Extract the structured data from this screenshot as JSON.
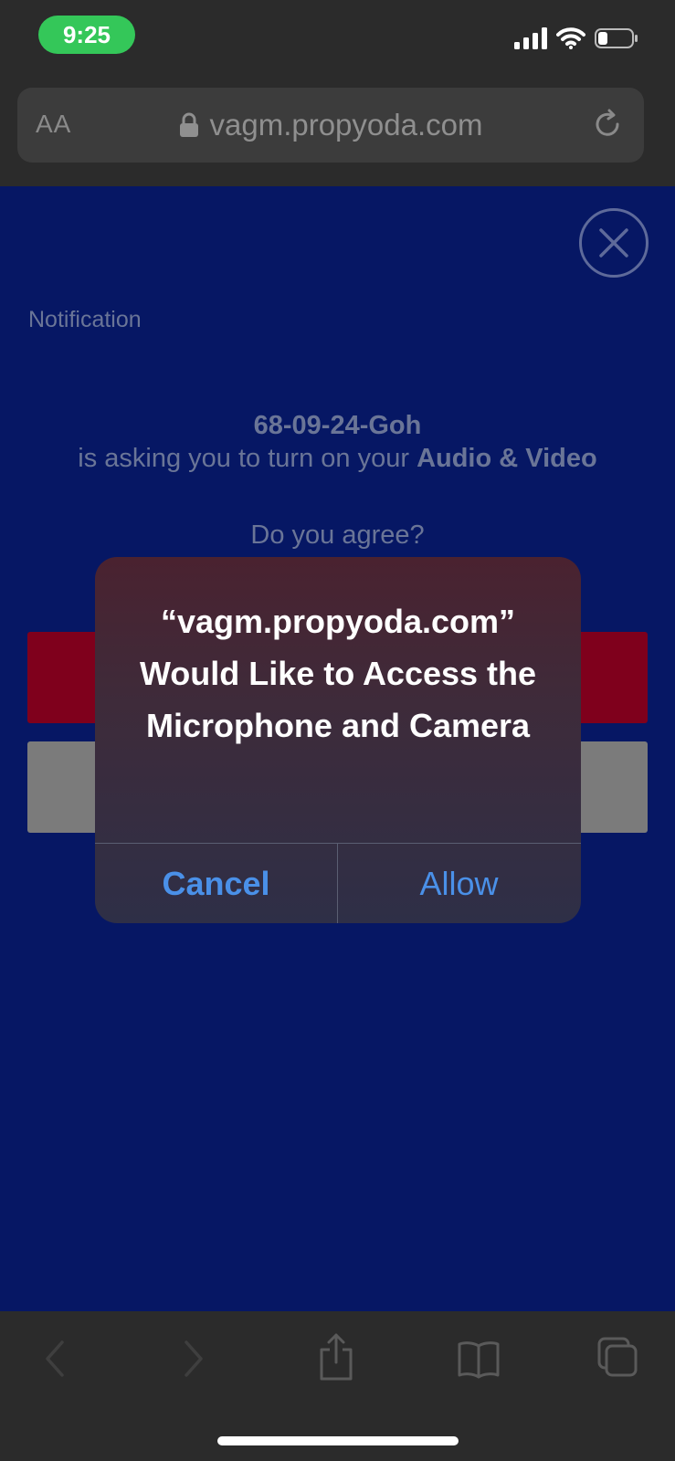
{
  "status_bar": {
    "time": "9:25",
    "icons": [
      "signal-icon",
      "wifi-icon",
      "battery-icon"
    ]
  },
  "browser": {
    "text_size_label": "AA",
    "url": "vagm.propyoda.com",
    "icons": [
      "lock-icon",
      "reload-icon"
    ]
  },
  "page": {
    "notification_label": "Notification",
    "requester": "68-09-24-Goh",
    "ask_text": "is asking you to turn on your",
    "ask_bold": "Audio & Video",
    "agree_question": "Do you agree?"
  },
  "alert": {
    "title": "“vagm.propyoda.com” Would Like to Access the Microphone and Camera",
    "cancel_label": "Cancel",
    "allow_label": "Allow"
  },
  "toolbar": {
    "icons": [
      "back-icon",
      "forward-icon",
      "share-icon",
      "bookmarks-icon",
      "tabs-icon"
    ]
  },
  "colors": {
    "page_background": "#061764",
    "alert_button": "#4a90e8",
    "time_pill": "#34c759"
  }
}
